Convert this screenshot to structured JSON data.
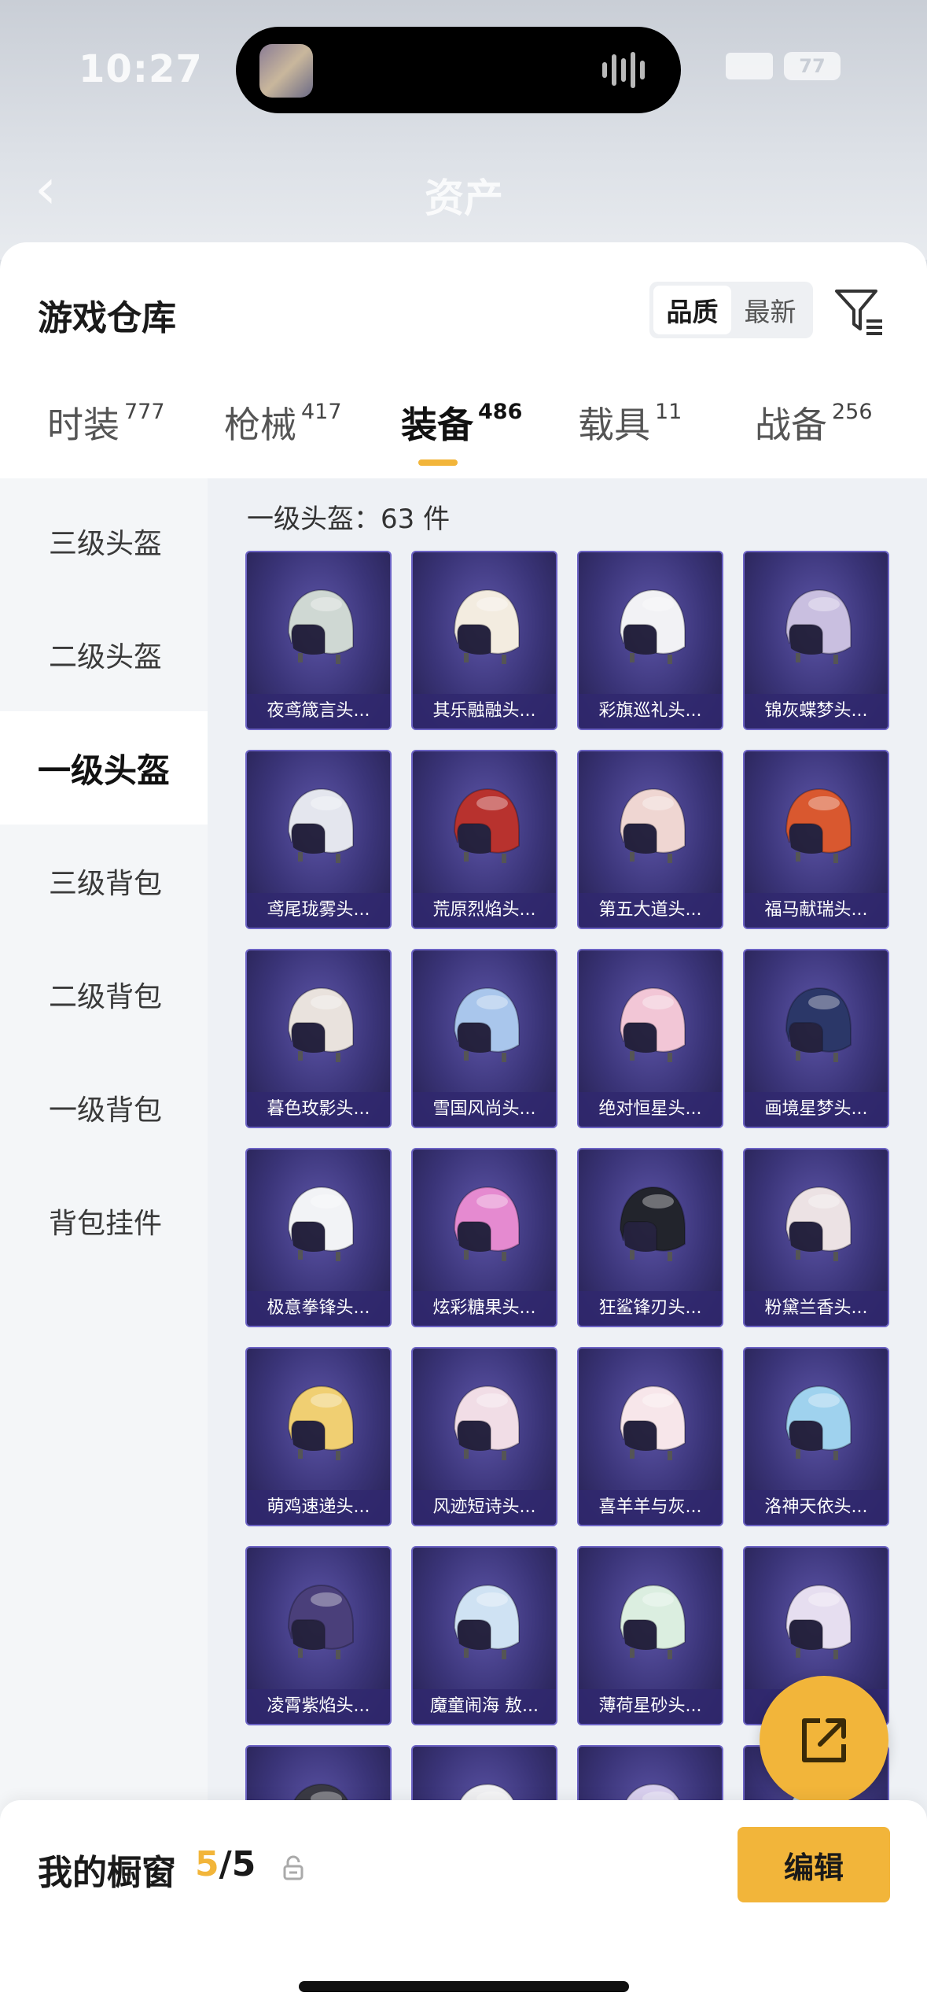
{
  "status_bar": {
    "time": "10:27",
    "battery": "77"
  },
  "header": {
    "title": "资产"
  },
  "warehouse": {
    "title": "游戏仓库",
    "sort_options": [
      "品质",
      "最新"
    ],
    "tabs": [
      {
        "label": "时装",
        "count": "777"
      },
      {
        "label": "枪械",
        "count": "417"
      },
      {
        "label": "装备",
        "count": "486"
      },
      {
        "label": "载具",
        "count": "11"
      },
      {
        "label": "战备",
        "count": "256"
      }
    ],
    "active_tab": "装备"
  },
  "sidebar": {
    "items": [
      "三级头盔",
      "二级头盔",
      "一级头盔",
      "三级背包",
      "二级背包",
      "一级背包",
      "背包挂件"
    ],
    "active": "一级头盔"
  },
  "content": {
    "heading": "一级头盔：63 件",
    "items": [
      {
        "label": "夜鸢箴言头...",
        "color": "#cfd8d3"
      },
      {
        "label": "其乐融融头...",
        "color": "#f3ece0"
      },
      {
        "label": "彩旗巡礼头...",
        "color": "#f2f2f5"
      },
      {
        "label": "锦灰蝶梦头...",
        "color": "#c9bfe0"
      },
      {
        "label": "鸢尾珑雾头...",
        "color": "#e4e6ee"
      },
      {
        "label": "荒原烈焰头...",
        "color": "#b8322e"
      },
      {
        "label": "第五大道头...",
        "color": "#efd6d2"
      },
      {
        "label": "福马献瑞头...",
        "color": "#d9582f"
      },
      {
        "label": "暮色玫影头...",
        "color": "#e9e2dd"
      },
      {
        "label": "雪国风尚头...",
        "color": "#a9c6ec"
      },
      {
        "label": "绝对恒星头...",
        "color": "#f2c6d6"
      },
      {
        "label": "画境星梦头...",
        "color": "#2b3768"
      },
      {
        "label": "极意拳锋头...",
        "color": "#f2f3f6"
      },
      {
        "label": "炫彩糖果头...",
        "color": "#e58ad0"
      },
      {
        "label": "狂鲨锋刃头...",
        "color": "#22242c"
      },
      {
        "label": "粉黛兰香头...",
        "color": "#ece2e4"
      },
      {
        "label": "萌鸡速递头...",
        "color": "#f0cf72"
      },
      {
        "label": "风迹短诗头...",
        "color": "#f1dde6"
      },
      {
        "label": "喜羊羊与灰...",
        "color": "#f7e6ea"
      },
      {
        "label": "洛神天依头...",
        "color": "#9fd2ee"
      },
      {
        "label": "凌霄紫焰头...",
        "color": "#4a3f7a"
      },
      {
        "label": "魔童闹海 敖...",
        "color": "#cfe2f3"
      },
      {
        "label": "薄荷星砂头...",
        "color": "#dbeee0"
      },
      {
        "label": "",
        "color": "#e6def0"
      },
      {
        "label": "",
        "color": "#3a3a44"
      },
      {
        "label": "",
        "color": "#f0f0f2"
      },
      {
        "label": "",
        "color": "#d8cfee"
      },
      {
        "label": "",
        "color": "#cde4f4"
      }
    ]
  },
  "showcase": {
    "title": "我的橱窗",
    "used": "5",
    "total": "/5",
    "edit_label": "编辑"
  },
  "accent_color": "#f2b53a"
}
